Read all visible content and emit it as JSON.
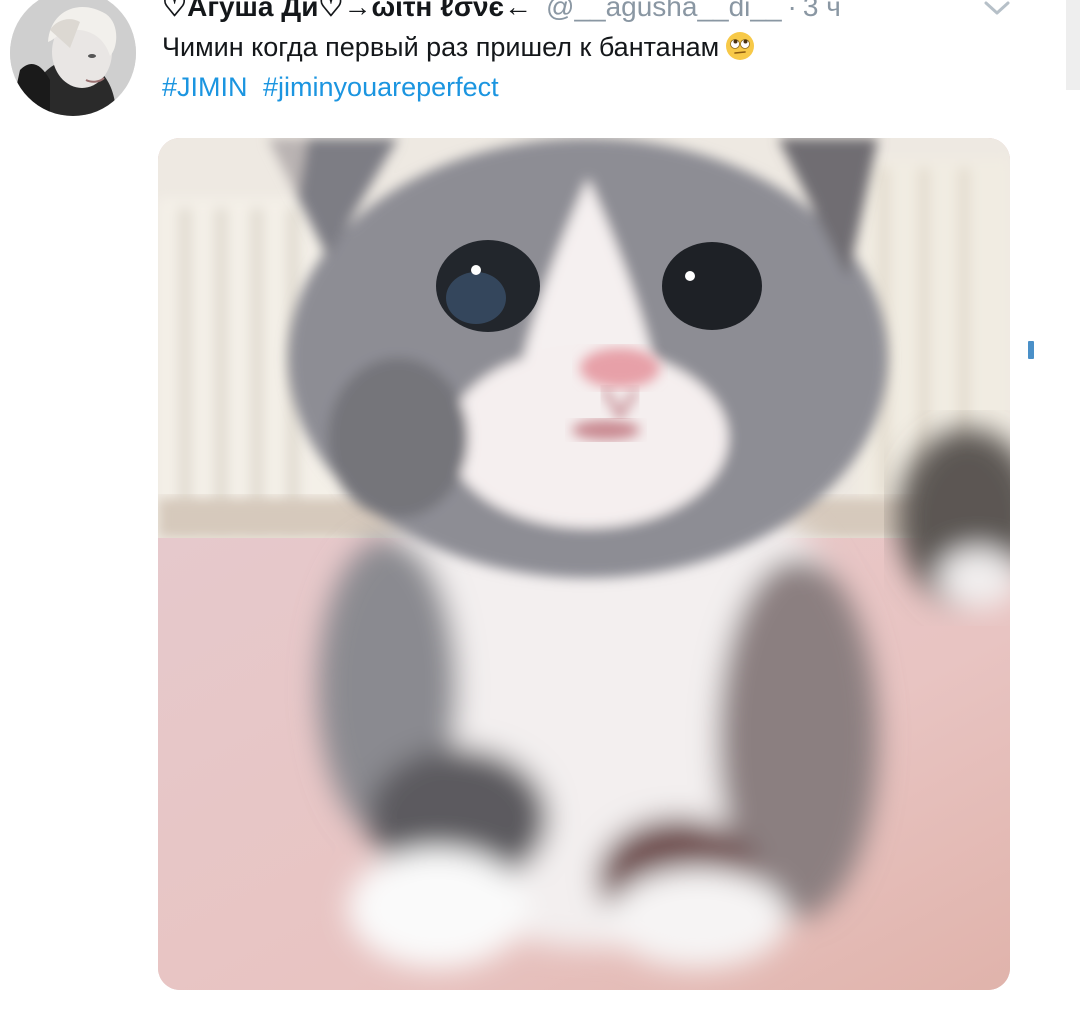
{
  "tweet": {
    "display_name": "♡Агуша Ди♡→ωιτн ℓσνє←",
    "handle": "@__agusha__di__",
    "separator": "·",
    "time": "3 ч",
    "text": "Чимин когда первый раз пришел к бантанам",
    "emoji": "face-with-rolling-eyes-emoji",
    "hashtags": [
      "#JIMIN",
      "#jiminyouareperfect"
    ],
    "media": {
      "kind": "photo",
      "subject": "cat-photo"
    }
  },
  "colors": {
    "text": "#14171a",
    "secondary": "#8a97a3",
    "link": "#1b95e0",
    "background": "#ffffff"
  },
  "icons": {
    "menu": "chevron-down-icon",
    "avatar": "avatar"
  }
}
